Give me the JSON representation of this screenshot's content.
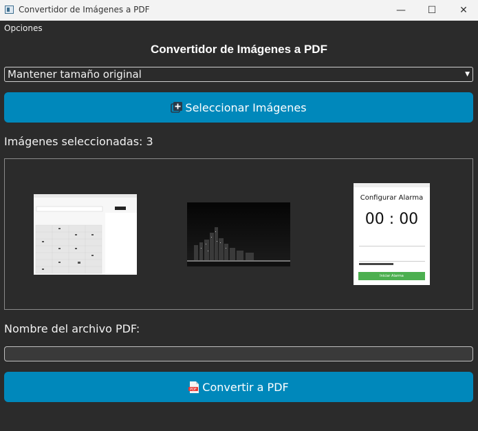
{
  "window": {
    "title": "Convertidor de Imágenes a PDF",
    "controls": [
      "—",
      "☐",
      "✕"
    ]
  },
  "menu": {
    "options": "Opciones"
  },
  "header": {
    "title": "Convertidor de Imágenes a PDF"
  },
  "size_select": {
    "selected": "Mantener tamaño original"
  },
  "select_button": {
    "label": "Seleccionar Imágenes",
    "icon": "add-images-icon"
  },
  "selected_count": {
    "text": "Imágenes seleccionadas: 3"
  },
  "thumbnails": {
    "alarm": {
      "title": "Configurar Alarma",
      "time": "00 : 00",
      "button": "Iniciar Alarma"
    }
  },
  "filename": {
    "label": "Nombre del archivo PDF:",
    "value": ""
  },
  "convert_button": {
    "label": "Convertir a PDF",
    "icon": "pdf-icon"
  },
  "colors": {
    "accent": "#0088bb",
    "background": "#2b2b2b",
    "text": "#f2f2f2"
  }
}
